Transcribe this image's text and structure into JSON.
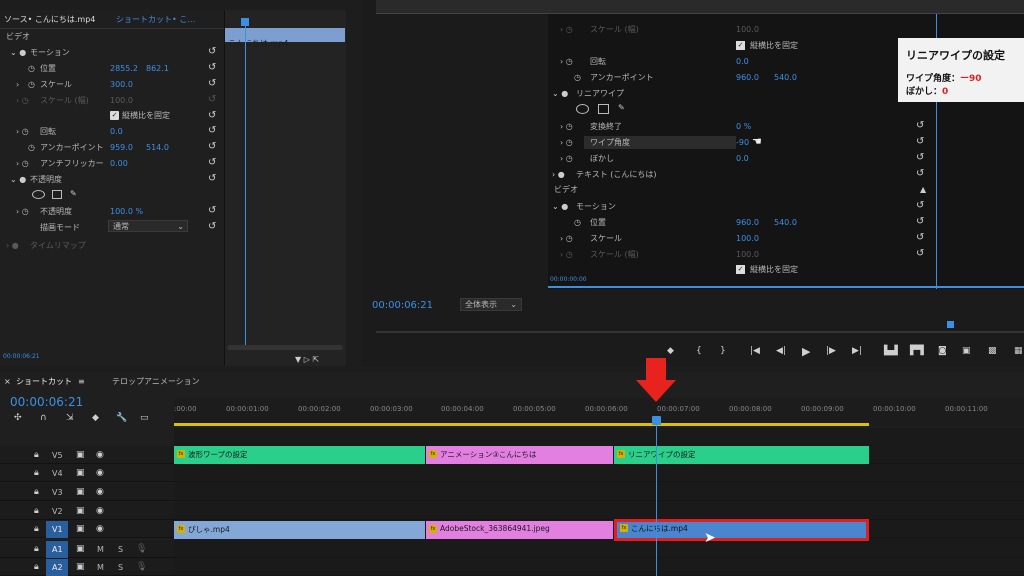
{
  "ec": {
    "tab": "ソース• こんにちは.mp4",
    "tab2": "ショートカット• こ…",
    "video": "ビデオ",
    "motion": "モーション",
    "position": "位置",
    "pos_x": "2855.2",
    "pos_y": "862.1",
    "scale": "スケール",
    "scale_v": "300.0",
    "scale_w": "スケール (幅)",
    "scale_w_v": "100.0",
    "uniform": "縦横比を固定",
    "rotation": "回転",
    "rot_v": "0.0",
    "anchor": "アンカーポイント",
    "anc_x": "959.0",
    "anc_y": "514.0",
    "flicker": "アンチフリッカー",
    "flicker_v": "0.00",
    "opacity": "不透明度",
    "opacity2": "不透明度",
    "opacity_v": "100.0 %",
    "blend": "描画モード",
    "blend_v": "通常",
    "timeremap": "タイムリマップ",
    "time": "00:00:06:21",
    "clipname": "こんにちは.mp4"
  },
  "mon": {
    "scale_w": "スケール (幅)",
    "scale_w_v": "100.0",
    "uniform": "縦横比を固定",
    "rotation": "回転",
    "rot_v": "0.0",
    "anchor": "アンカーポイント",
    "anc_x": "960.0",
    "anc_y": "540.0",
    "linear": "リニアワイプ",
    "transition": "変換終了",
    "trans_v": "0 %",
    "angle": "ワイプ角度",
    "angle_v": "-90",
    "feather": "ぼかし",
    "feather_v": "0.0",
    "text": "テキスト (こんにちは)",
    "video": "ビデオ",
    "motion": "モーション",
    "position": "位置",
    "pos_x": "960.0",
    "pos_y": "540.0",
    "scale": "スケール",
    "scale_v": "100.0",
    "scale_w2": "スケール (幅)",
    "scale_w2_v": "100.0",
    "uniform2": "縦横比を固定",
    "mini_time": "00:00:00:00",
    "time": "00:00:06:21",
    "zoom": "全体表示"
  },
  "callout": {
    "title": "リニアワイプの設定",
    "l1": "ワイプ角度：",
    "v1": "ー90",
    "l2": "ぼかし：",
    "v2": "0",
    "accent": "#e02020"
  },
  "tl": {
    "tab1": "ショートカット",
    "tab2": "テロップアニメーション",
    "time": "00:00:06:21",
    "ruler": [
      ":00:00",
      "00:00:01:00",
      "00:00:02:00",
      "00:00:03:00",
      "00:00:04:00",
      "00:00:05:00",
      "00:00:06:00",
      "00:00:07:00",
      "00:00:08:00",
      "00:00:09:00",
      "00:00:10:00",
      "00:00:11:00"
    ],
    "tracks": [
      "V5",
      "V4",
      "V3",
      "V2",
      "V1",
      "A1",
      "A2"
    ],
    "clips_v5": [
      "波形ワープの設定",
      "アニメーション③こんにちは",
      "リニアワイプの設定"
    ],
    "clips_v1": [
      "ぴしゃ.mp4",
      "AdobeStock_363864941.jpeg",
      "こんにちは.mp4"
    ],
    "m": "M",
    "s": "S"
  }
}
